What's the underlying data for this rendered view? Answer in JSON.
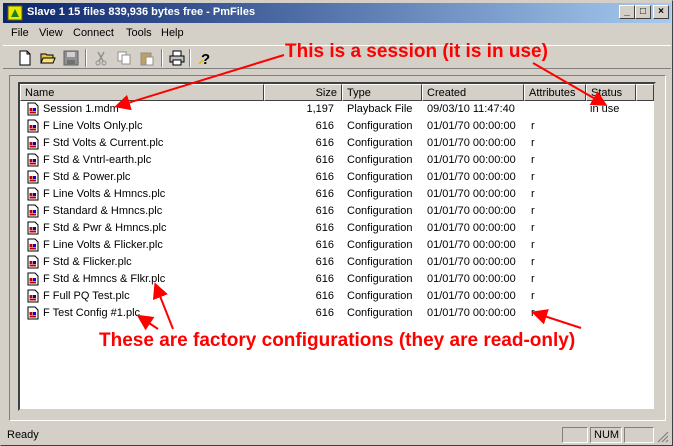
{
  "window": {
    "title": "Slave 1 15 files 839,936 bytes free - PmFiles"
  },
  "caption_buttons": {
    "minimize": "_",
    "maximize": "□",
    "close": "×"
  },
  "menu": [
    "File",
    "View",
    "Connect",
    "Tools",
    "Help"
  ],
  "toolbar": [
    "new-icon",
    "open-icon",
    "save-icon",
    "cut-icon",
    "copy-icon",
    "paste-icon",
    "print-icon",
    "help-icon"
  ],
  "columns": {
    "name": "Name",
    "size": "Size",
    "type": "Type",
    "created": "Created",
    "attributes": "Attributes",
    "status": "Status"
  },
  "files": [
    {
      "name": "Session 1.mdm",
      "size": "1,197",
      "type": "Playback File",
      "created": "09/03/10 11:47:40",
      "attributes": "",
      "status": "in use"
    },
    {
      "name": "F Line Volts Only.plc",
      "size": "616",
      "type": "Configuration",
      "created": "01/01/70 00:00:00",
      "attributes": "r",
      "status": ""
    },
    {
      "name": "F Std Volts & Current.plc",
      "size": "616",
      "type": "Configuration",
      "created": "01/01/70 00:00:00",
      "attributes": "r",
      "status": ""
    },
    {
      "name": "F Std & Vntrl-earth.plc",
      "size": "616",
      "type": "Configuration",
      "created": "01/01/70 00:00:00",
      "attributes": "r",
      "status": ""
    },
    {
      "name": "F Std & Power.plc",
      "size": "616",
      "type": "Configuration",
      "created": "01/01/70 00:00:00",
      "attributes": "r",
      "status": ""
    },
    {
      "name": "F Line Volts & Hmncs.plc",
      "size": "616",
      "type": "Configuration",
      "created": "01/01/70 00:00:00",
      "attributes": "r",
      "status": ""
    },
    {
      "name": "F Standard & Hmncs.plc",
      "size": "616",
      "type": "Configuration",
      "created": "01/01/70 00:00:00",
      "attributes": "r",
      "status": ""
    },
    {
      "name": "F Std & Pwr & Hmncs.plc",
      "size": "616",
      "type": "Configuration",
      "created": "01/01/70 00:00:00",
      "attributes": "r",
      "status": ""
    },
    {
      "name": "F Line Volts & Flicker.plc",
      "size": "616",
      "type": "Configuration",
      "created": "01/01/70 00:00:00",
      "attributes": "r",
      "status": ""
    },
    {
      "name": "F Std & Flicker.plc",
      "size": "616",
      "type": "Configuration",
      "created": "01/01/70 00:00:00",
      "attributes": "r",
      "status": ""
    },
    {
      "name": "F Std & Hmncs & Flkr.plc",
      "size": "616",
      "type": "Configuration",
      "created": "01/01/70 00:00:00",
      "attributes": "r",
      "status": ""
    },
    {
      "name": "F Full PQ Test.plc",
      "size": "616",
      "type": "Configuration",
      "created": "01/01/70 00:00:00",
      "attributes": "r",
      "status": ""
    },
    {
      "name": "F Test Config #1.plc",
      "size": "616",
      "type": "Configuration",
      "created": "01/01/70 00:00:00",
      "attributes": "r",
      "status": ""
    }
  ],
  "annotations": {
    "top": "This is a session (it is in use)",
    "bottom": "These are factory configurations (they are read-only)",
    "color": "#ff0000"
  },
  "status": {
    "text": "Ready",
    "num": "NUM"
  }
}
